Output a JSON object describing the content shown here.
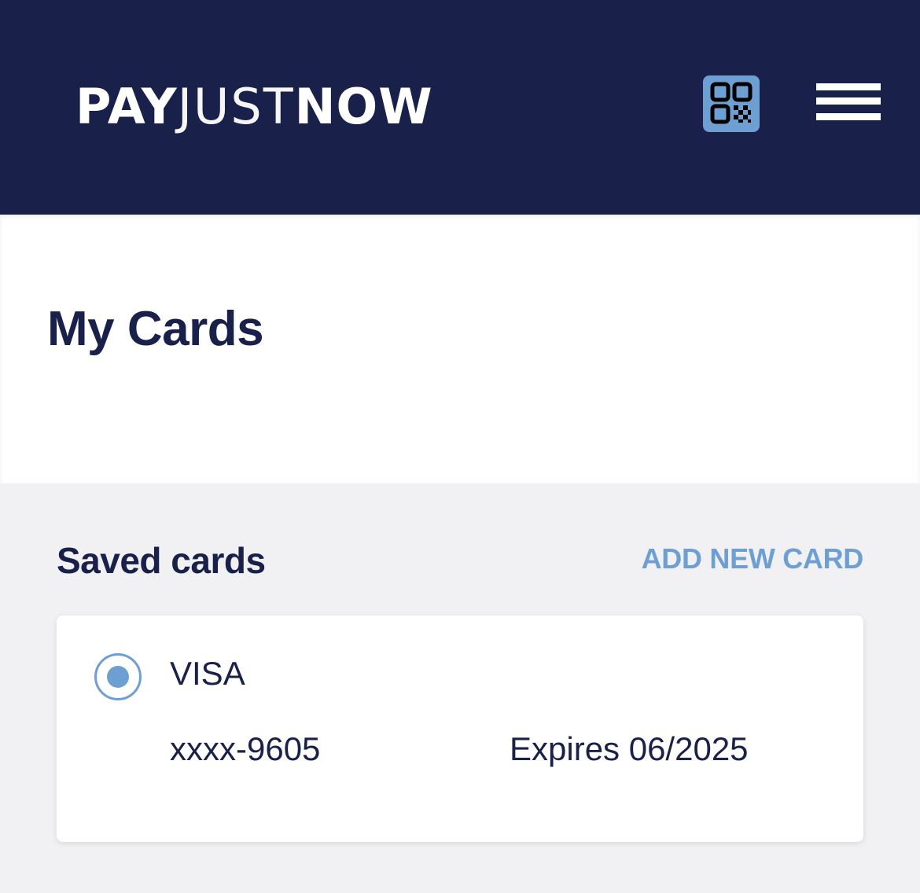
{
  "header": {
    "logo": {
      "part1": "PAY",
      "part2": "JUST",
      "part3": "NOW"
    },
    "qr_icon": "qr-code-icon",
    "menu_icon": "hamburger-menu-icon"
  },
  "page": {
    "title": "My Cards"
  },
  "saved_cards": {
    "title": "Saved cards",
    "add_label": "ADD NEW CARD",
    "cards": [
      {
        "brand": "VISA",
        "number": "xxxx-9605",
        "expiry": "Expires 06/2025",
        "selected": true
      }
    ]
  },
  "colors": {
    "navy": "#19214a",
    "accent": "#6e9fd3",
    "background": "#f1f1f3"
  }
}
